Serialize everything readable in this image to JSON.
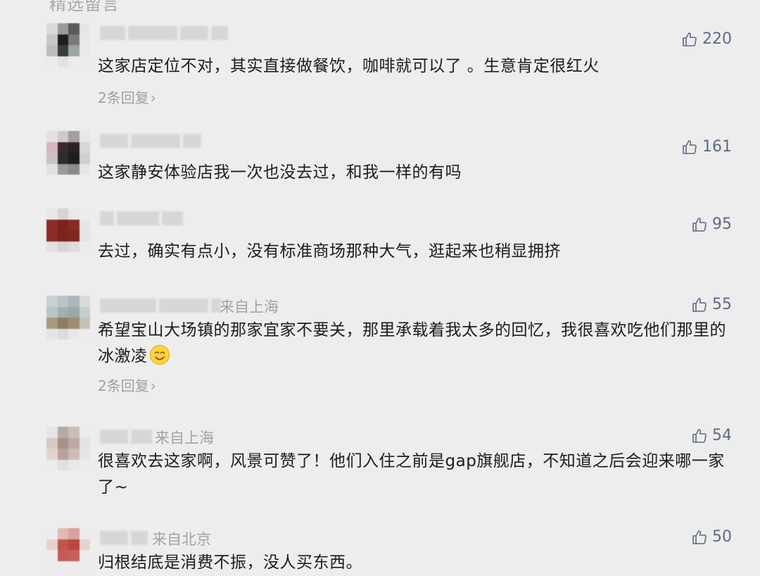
{
  "section_title": "精选留言",
  "thumb_color": "#5b6b85",
  "comments": [
    {
      "location": "",
      "likes": "220",
      "text": "这家店定位不对，其实直接做餐饮，咖啡就可以了 。生意肯定很红火",
      "replies": "2条回复",
      "avatar_colors": [
        "#d9d9d9",
        "#9a9a9a",
        "#5a5a5a",
        "#e6e6e6",
        "#c8c8c8",
        "#1f1f1f",
        "#7a7a7a",
        "#e8e8e8",
        "#bdbdbd",
        "#3a3a3a",
        "#9aa6a4",
        "#e9e9e9",
        "#ececec",
        "#e2e2e2",
        "#ececec",
        "#ececec"
      ]
    },
    {
      "location": "",
      "likes": "161",
      "text": "这家静安体验店我一次也没去过，和我一样的有吗",
      "replies": "",
      "avatar_colors": [
        "#e2e2e2",
        "#cfc8cc",
        "#a89ca3",
        "#e7e7e7",
        "#d7b6bd",
        "#3a2a32",
        "#2a2228",
        "#d8d8d8",
        "#c9c1c4",
        "#2c2c2c",
        "#1e1e1e",
        "#cfcfcf",
        "#e2e2e2",
        "#9a9a9a",
        "#8a8a8a",
        "#e6e6e6"
      ]
    },
    {
      "location": "",
      "likes": "95",
      "text": "去过，确实有点小，没有标准商场那种大气，逛起来也稍显拥挤",
      "replies": "",
      "avatar_colors": [
        "#e8e8e8",
        "#d9d4d4",
        "#e9e9e9",
        "#ececec",
        "#8e2b26",
        "#7a221e",
        "#8a2a24",
        "#e6e6e6",
        "#8c2a25",
        "#7d241f",
        "#80261f",
        "#e4e4e4",
        "#e4e0e0",
        "#d9d2d2",
        "#e1dcdc",
        "#ececec"
      ]
    },
    {
      "location": "来自上海",
      "likes": "55",
      "text": "希望宝山大场镇的那家宜家不要关，那里承载着我太多的回忆，我很喜欢吃他们那里的冰激凌",
      "replies": "2条回复",
      "avatar_colors": [
        "#c8d0d2",
        "#b9c4c6",
        "#aab6b8",
        "#d6dcdc",
        "#b8c6c2",
        "#9fb1ac",
        "#98aaa6",
        "#c4cfcd",
        "#a89a82",
        "#8e7d63",
        "#9d8d74",
        "#c7c2b6",
        "#e4e4e4",
        "#dcdcdc",
        "#e8e8e8",
        "#ececec"
      ]
    },
    {
      "location": "来自上海",
      "likes": "54",
      "text": "很喜欢去这家啊，风景可赞了！他们入住之前是gap旗舰店，不知道之后会迎来哪一家了~",
      "replies": "",
      "avatar_colors": [
        "#e6e6e6",
        "#b8a9a5",
        "#c9bdb9",
        "#ececec",
        "#d6c8c4",
        "#a8918b",
        "#bca9a4",
        "#e2e2e2",
        "#e0d4d1",
        "#b9a29d",
        "#cdbcb8",
        "#e6e6e6",
        "#ececec",
        "#e0e0e0",
        "#e8e8e8",
        "#ececec"
      ]
    },
    {
      "location": "来自北京",
      "likes": "50",
      "text": "归根结底是消费不振，没人买东西。",
      "replies": "",
      "avatar_colors": [
        "#ececec",
        "#e3b8b4",
        "#d8a39e",
        "#ececec",
        "#e8d0cd",
        "#c2554c",
        "#b8473f",
        "#e6d2cf",
        "#ececec",
        "#c85b52",
        "#c9605a",
        "#ececec",
        "#ececec",
        "#ececec",
        "#ececec",
        "#ececec"
      ]
    }
  ]
}
